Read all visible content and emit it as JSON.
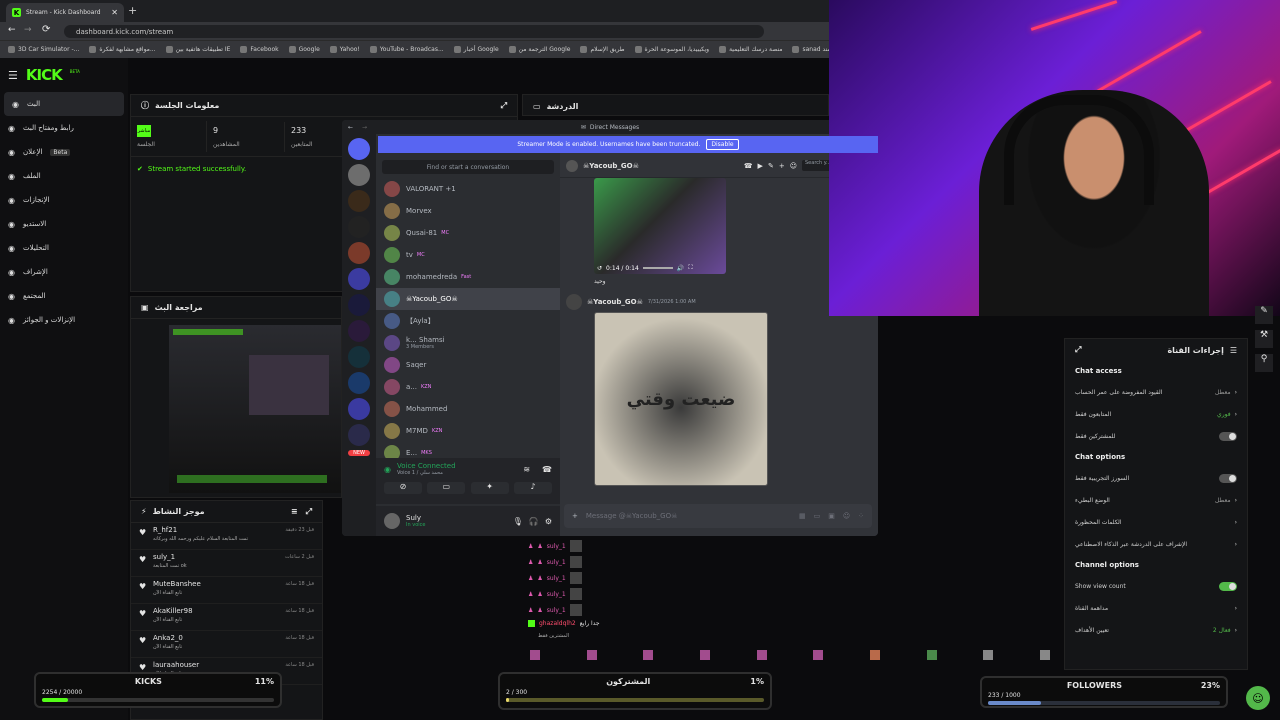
{
  "browser": {
    "tab_title": "Stream - Kick Dashboard",
    "url": "dashboard.kick.com/stream",
    "bookmarks": [
      "3D Car Simulator -...",
      "مواقع مشابهة لفكرة...",
      "تطبيقات هاتفية بين IE",
      "Facebook",
      "Google",
      "Yahoo!",
      "YouTube - Broadcas...",
      "أخبار Google",
      "الترجمة من Google",
      "طريق الإسلام",
      "ويكيبيديا، الموسوعة الحرة",
      "منصة درسك التعليمية",
      "sanad سند"
    ]
  },
  "kick": {
    "logo": "KICK",
    "beta": "BETA",
    "nav": [
      {
        "label": "البث",
        "icon": "broadcast-icon",
        "active": true
      },
      {
        "label": "رابط ومفتاح البث",
        "icon": "key-icon"
      },
      {
        "label": "الإعلان",
        "icon": "ad-icon",
        "badge": "Beta"
      },
      {
        "label": "الملف",
        "icon": "user-icon"
      },
      {
        "label": "الإنجازات",
        "icon": "trophy-icon"
      },
      {
        "label": "الاستديو",
        "icon": "studio-icon"
      },
      {
        "label": "التحليلات",
        "icon": "chart-icon"
      },
      {
        "label": "الإشراف",
        "icon": "shield-icon"
      },
      {
        "label": "المجتمع",
        "icon": "community-icon"
      },
      {
        "label": "الإنزالات و الجوائز",
        "icon": "gift-icon"
      }
    ]
  },
  "session": {
    "title": "معلومات الجلسة",
    "stats": [
      {
        "value": "",
        "label": "الجلسة",
        "live": "مباشر"
      },
      {
        "value": "9",
        "label": "المشاهدين"
      },
      {
        "value": "233",
        "label": "المتابعين"
      }
    ],
    "status": "Stream started successfully."
  },
  "chat_header": "الدردشة",
  "preview_title": "مراجعة البث",
  "activity": {
    "title": "موجز النشاط",
    "items": [
      {
        "user": "R_hf21",
        "time": "قبل 23 دقيقة",
        "text": "تمت المتابعة السلام عليكم ورحمه الله وبركاته"
      },
      {
        "user": "suly_1",
        "time": "قبل 2 ساعات",
        "text": "تمت المتابعة ok"
      },
      {
        "user": "MuteBanshee",
        "time": "قبل 18 ساعة",
        "text": "تابع القناة الآن"
      },
      {
        "user": "AkaKiller98",
        "time": "قبل 18 ساعة",
        "text": "تابع القناة الآن"
      },
      {
        "user": "Anka2_0",
        "time": "قبل 18 ساعة",
        "text": "تابع القناة الآن"
      },
      {
        "user": "lauraahouser",
        "time": "قبل 18 ساعة",
        "text": "تابع القناة الآن"
      }
    ]
  },
  "discord": {
    "title": "Direct Messages",
    "banner": "Streamer Mode is enabled. Usernames have been truncated.",
    "banner_btn": "Disable",
    "search": "Find or start a conversation",
    "chat_search": "Search y...",
    "dms": [
      {
        "name": "VALORANT +1"
      },
      {
        "name": "Morvex"
      },
      {
        "name": "Qusai-81",
        "tag": "MC"
      },
      {
        "name": "tv",
        "tag": "MC"
      },
      {
        "name": "mohamedreda",
        "tag": "Fast"
      },
      {
        "name": "☠Yacoub_GO☠",
        "active": true
      },
      {
        "name": "【Ayla】"
      },
      {
        "name": "k... Shamsi",
        "sub": "3 Members"
      },
      {
        "name": "Saqer"
      },
      {
        "name": "a...",
        "tag": "KZN"
      },
      {
        "name": "Mohammed"
      },
      {
        "name": "M7MD",
        "tag": "KZN"
      },
      {
        "name": "E...",
        "tag": "MKS"
      }
    ],
    "voice": {
      "status": "Voice Connected",
      "channel": "Voice 1 / محمد سلي"
    },
    "user": {
      "name": "Suly",
      "status": "In voice"
    },
    "chat_user": "☠Yacoub_GO☠",
    "video_time": "0:14 / 0:14",
    "msg1": "وحيد",
    "msg2_user": "☠Yacoub_GO☠",
    "msg2_time": "7/31/2026 1:00 AM",
    "art_text": "ضيعت وقتي",
    "input": "Message @☠Yacoub_GO☠",
    "new": "NEW"
  },
  "chat_msgs": [
    "suly_1",
    "suly_1",
    "suly_1",
    "suly_1",
    "suly_1"
  ],
  "chat_extra": {
    "user": "ghazaldqlh2",
    "text": "جدا رايع"
  },
  "chat_note": "المشترين فقط",
  "actions": {
    "title": "إجراءات القناة",
    "access": "Chat access",
    "rows1": [
      {
        "label": "القيود المفروضة على عمر الحساب",
        "value": "معطل"
      },
      {
        "label": "المتابعون فقط",
        "value": "فوري"
      },
      {
        "label": "للمشتركين فقط",
        "toggle": false
      }
    ],
    "options": "Chat options",
    "rows2": [
      {
        "label": "السورز التجريبية فقط",
        "toggle": false
      },
      {
        "label": "الوضع البطيء",
        "value": "معطل"
      },
      {
        "label": "الكلمات المحظورة"
      },
      {
        "label": "الإشراف على الدردشة عبر الذكاء الاصطناعي"
      }
    ],
    "channel": "Channel options",
    "rows3": [
      {
        "label": "Show view count",
        "toggle": true
      },
      {
        "label": "مداهمة القناة"
      },
      {
        "label": "تعيين الأهداف",
        "value": "فعال 2"
      }
    ]
  },
  "goals": {
    "kicks": {
      "label": "KICKS",
      "count": "2254 / 20000",
      "pct": "11%",
      "fill": 0.11
    },
    "subs": {
      "label": "المشتركون",
      "count": "2 / 300",
      "pct": "1%",
      "fill": 0.01
    },
    "followers": {
      "label": "FOLLOWERS",
      "count": "233 / 1000",
      "pct": "23%",
      "fill": 0.23
    }
  },
  "colors": {
    "kick": "#53fc18",
    "discord": "#5865f2"
  }
}
